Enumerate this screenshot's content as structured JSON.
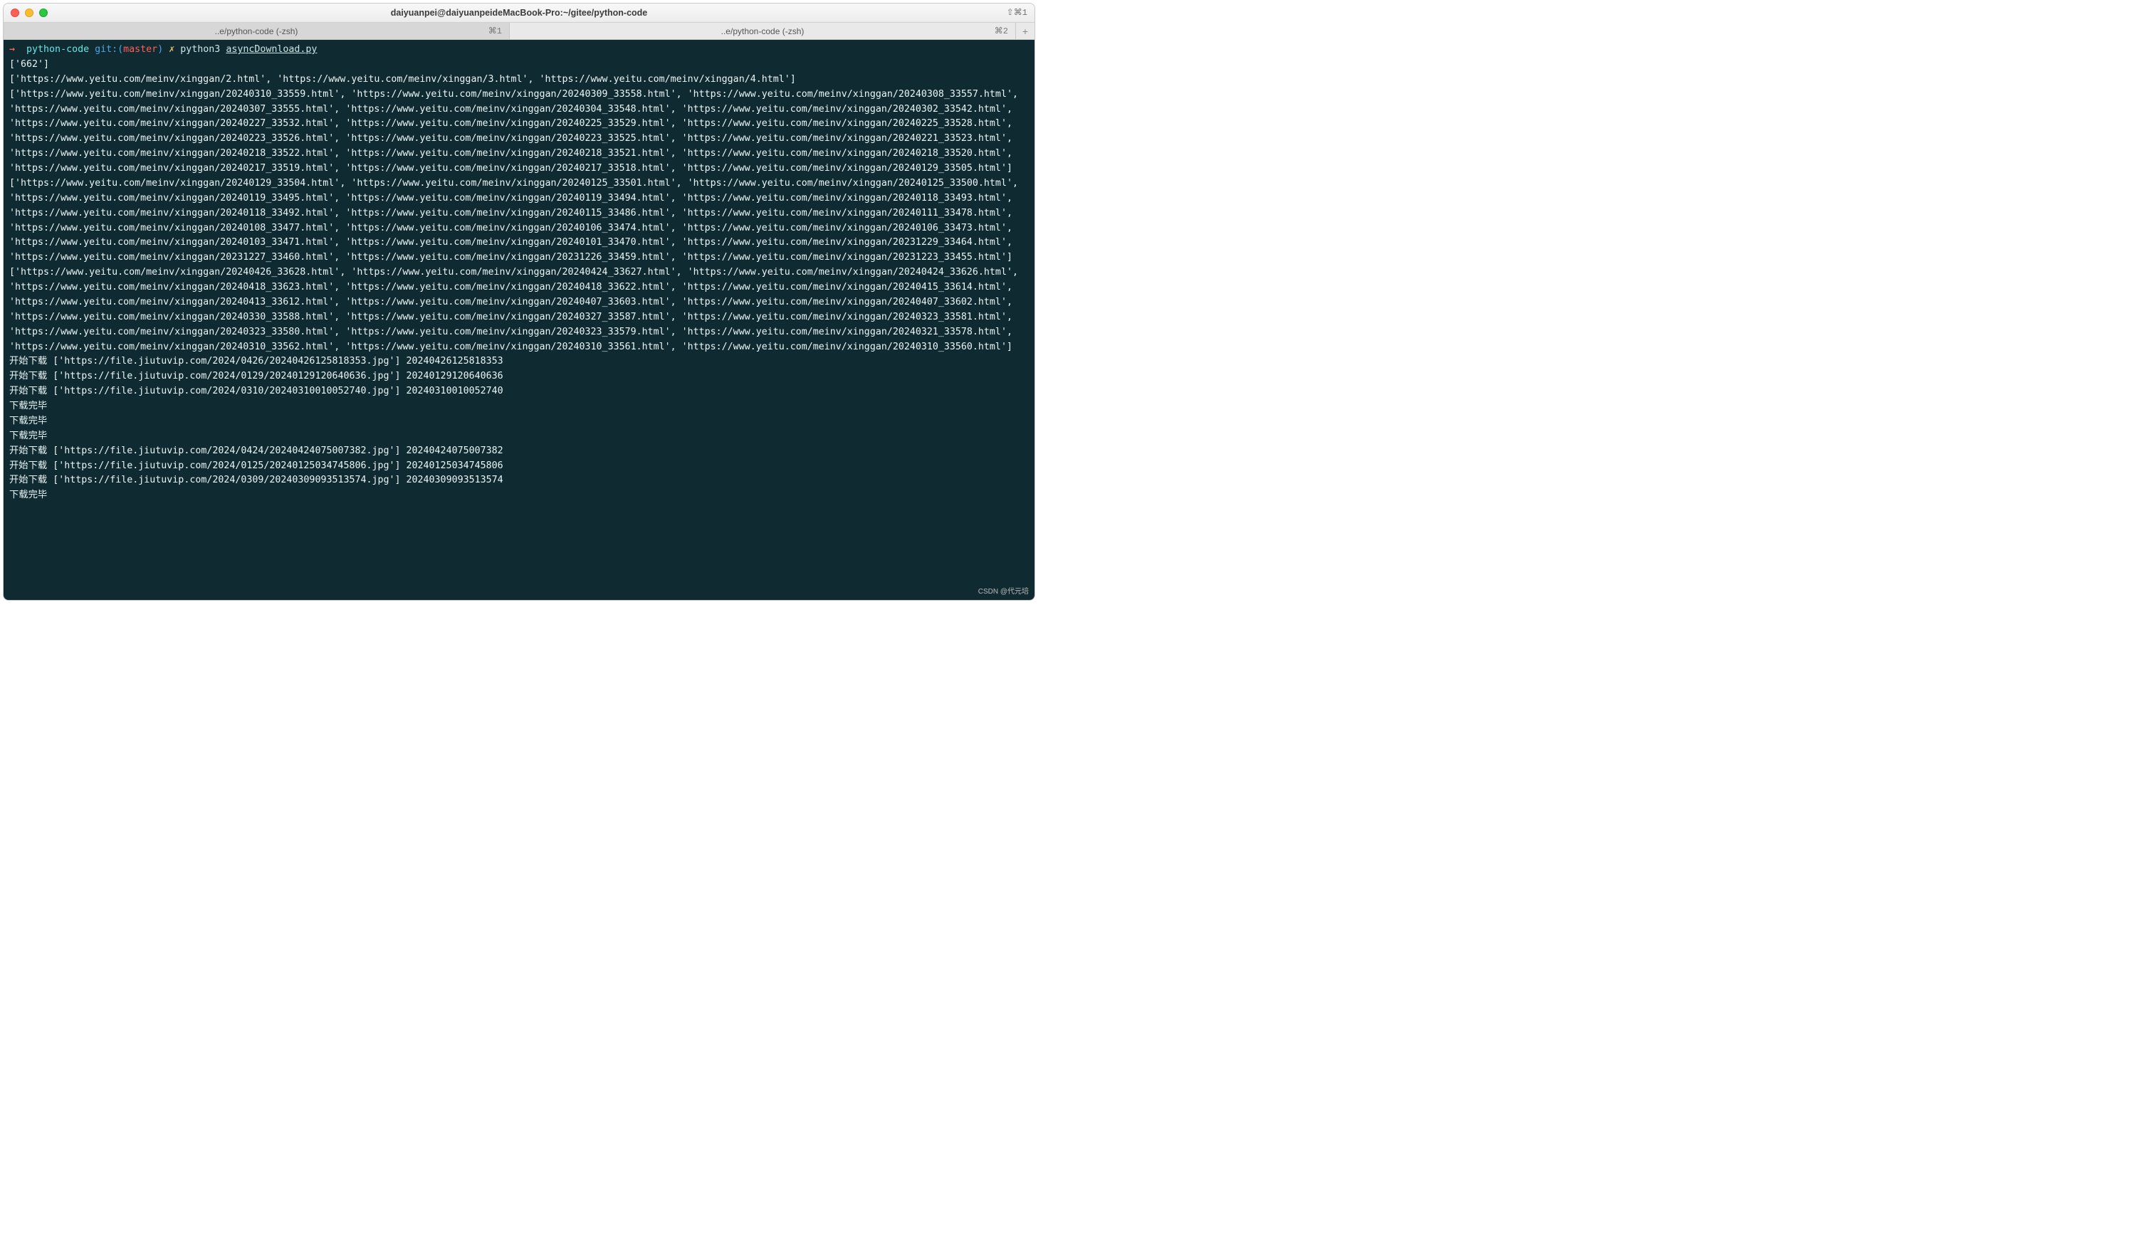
{
  "window": {
    "title": "daiyuanpei@daiyuanpeideMacBook-Pro:~/gitee/python-code",
    "hotkey": "⇧⌘1"
  },
  "tabs": {
    "items": [
      {
        "label": "..e/python-code (-zsh)",
        "hotkey": "⌘1",
        "active": true
      },
      {
        "label": "..e/python-code (-zsh)",
        "hotkey": "⌘2",
        "active": false
      }
    ],
    "add": "+"
  },
  "prompt": {
    "arrow": "→",
    "dir": "python-code",
    "git_label": "git:(",
    "branch": "master",
    "git_close": ")",
    "dirty": "✗",
    "command_bin": "python3",
    "command_arg": "asyncDownload.py"
  },
  "output": {
    "line0": "['662']",
    "list1": "['https://www.yeitu.com/meinv/xinggan/2.html', 'https://www.yeitu.com/meinv/xinggan/3.html', 'https://www.yeitu.com/meinv/xinggan/4.html']",
    "list2": "['https://www.yeitu.com/meinv/xinggan/20240310_33559.html', 'https://www.yeitu.com/meinv/xinggan/20240309_33558.html', 'https://www.yeitu.com/meinv/xinggan/20240308_33557.html', 'https://www.yeitu.com/meinv/xinggan/20240307_33555.html', 'https://www.yeitu.com/meinv/xinggan/20240304_33548.html', 'https://www.yeitu.com/meinv/xinggan/20240302_33542.html', 'https://www.yeitu.com/meinv/xinggan/20240227_33532.html', 'https://www.yeitu.com/meinv/xinggan/20240225_33529.html', 'https://www.yeitu.com/meinv/xinggan/20240225_33528.html', 'https://www.yeitu.com/meinv/xinggan/20240223_33526.html', 'https://www.yeitu.com/meinv/xinggan/20240223_33525.html', 'https://www.yeitu.com/meinv/xinggan/20240221_33523.html', 'https://www.yeitu.com/meinv/xinggan/20240218_33522.html', 'https://www.yeitu.com/meinv/xinggan/20240218_33521.html', 'https://www.yeitu.com/meinv/xinggan/20240218_33520.html', 'https://www.yeitu.com/meinv/xinggan/20240217_33519.html', 'https://www.yeitu.com/meinv/xinggan/20240217_33518.html', 'https://www.yeitu.com/meinv/xinggan/20240129_33505.html']",
    "list3": "['https://www.yeitu.com/meinv/xinggan/20240129_33504.html', 'https://www.yeitu.com/meinv/xinggan/20240125_33501.html', 'https://www.yeitu.com/meinv/xinggan/20240125_33500.html', 'https://www.yeitu.com/meinv/xinggan/20240119_33495.html', 'https://www.yeitu.com/meinv/xinggan/20240119_33494.html', 'https://www.yeitu.com/meinv/xinggan/20240118_33493.html', 'https://www.yeitu.com/meinv/xinggan/20240118_33492.html', 'https://www.yeitu.com/meinv/xinggan/20240115_33486.html', 'https://www.yeitu.com/meinv/xinggan/20240111_33478.html', 'https://www.yeitu.com/meinv/xinggan/20240108_33477.html', 'https://www.yeitu.com/meinv/xinggan/20240106_33474.html', 'https://www.yeitu.com/meinv/xinggan/20240106_33473.html', 'https://www.yeitu.com/meinv/xinggan/20240103_33471.html', 'https://www.yeitu.com/meinv/xinggan/20240101_33470.html', 'https://www.yeitu.com/meinv/xinggan/20231229_33464.html', 'https://www.yeitu.com/meinv/xinggan/20231227_33460.html', 'https://www.yeitu.com/meinv/xinggan/20231226_33459.html', 'https://www.yeitu.com/meinv/xinggan/20231223_33455.html']",
    "list4": "['https://www.yeitu.com/meinv/xinggan/20240426_33628.html', 'https://www.yeitu.com/meinv/xinggan/20240424_33627.html', 'https://www.yeitu.com/meinv/xinggan/20240424_33626.html', 'https://www.yeitu.com/meinv/xinggan/20240418_33623.html', 'https://www.yeitu.com/meinv/xinggan/20240418_33622.html', 'https://www.yeitu.com/meinv/xinggan/20240415_33614.html', 'https://www.yeitu.com/meinv/xinggan/20240413_33612.html', 'https://www.yeitu.com/meinv/xinggan/20240407_33603.html', 'https://www.yeitu.com/meinv/xinggan/20240407_33602.html', 'https://www.yeitu.com/meinv/xinggan/20240330_33588.html', 'https://www.yeitu.com/meinv/xinggan/20240327_33587.html', 'https://www.yeitu.com/meinv/xinggan/20240323_33581.html', 'https://www.yeitu.com/meinv/xinggan/20240323_33580.html', 'https://www.yeitu.com/meinv/xinggan/20240323_33579.html', 'https://www.yeitu.com/meinv/xinggan/20240321_33578.html', 'https://www.yeitu.com/meinv/xinggan/20240310_33562.html', 'https://www.yeitu.com/meinv/xinggan/20240310_33561.html', 'https://www.yeitu.com/meinv/xinggan/20240310_33560.html']",
    "dl1": "开始下载 ['https://file.jiutuvip.com/2024/0426/20240426125818353.jpg'] 20240426125818353",
    "dl2": "开始下载 ['https://file.jiutuvip.com/2024/0129/20240129120640636.jpg'] 20240129120640636",
    "dl3": "开始下载 ['https://file.jiutuvip.com/2024/0310/20240310010052740.jpg'] 20240310010052740",
    "done1": "下载完毕",
    "done2": "下载完毕",
    "done3": "下载完毕",
    "dl4": "开始下载 ['https://file.jiutuvip.com/2024/0424/20240424075007382.jpg'] 20240424075007382",
    "dl5": "开始下载 ['https://file.jiutuvip.com/2024/0125/20240125034745806.jpg'] 20240125034745806",
    "dl6": "开始下载 ['https://file.jiutuvip.com/2024/0309/20240309093513574.jpg'] 20240309093513574",
    "done4": "下载完毕"
  },
  "watermark": "CSDN @代元培"
}
